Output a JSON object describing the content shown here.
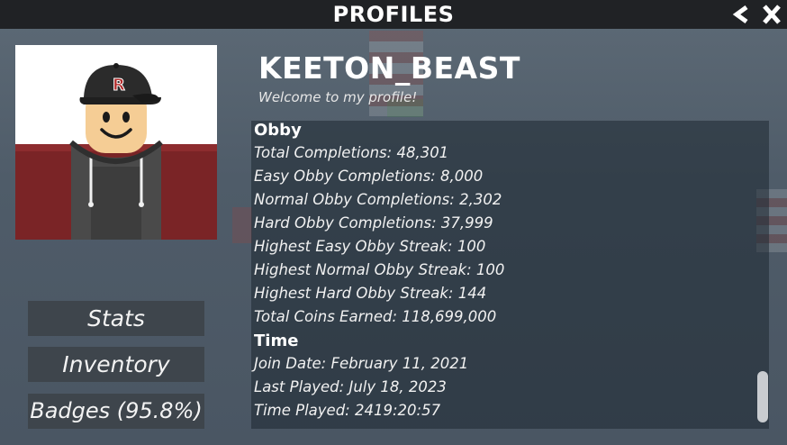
{
  "header": {
    "title": "PROFILES",
    "back_label": "<",
    "close_label": "X"
  },
  "profile": {
    "username": "KEETON_BEAST",
    "bio": "Welcome to my profile!"
  },
  "stats": {
    "sections": [
      {
        "heading": "Obby",
        "lines": [
          "Total Completions: 48,301",
          "Easy Obby Completions: 8,000",
          "Normal Obby Completions: 2,302",
          "Hard Obby Completions: 37,999",
          "Highest Easy Obby Streak: 100",
          "Highest Normal Obby Streak: 100",
          "Highest Hard Obby Streak: 144",
          "Total Coins Earned: 118,699,000"
        ]
      },
      {
        "heading": "Time",
        "lines": [
          "Join Date: February 11, 2021",
          "Last Played: July 18, 2023",
          "Time Played: 2419:20:57"
        ]
      }
    ]
  },
  "nav": {
    "stats_label": "Stats",
    "inventory_label": "Inventory",
    "badges_label": "Badges (95.8%)"
  },
  "avatar": {
    "cap_logo": "R",
    "colors": {
      "skin": "#f5cd95",
      "cap": "#2b2b2b",
      "cap_logo": "#b22b2b",
      "jacket": "#7a2426",
      "hoodie": "#4a4a4a"
    }
  },
  "icons": {
    "back": "chevron-left-icon",
    "close": "close-icon"
  }
}
